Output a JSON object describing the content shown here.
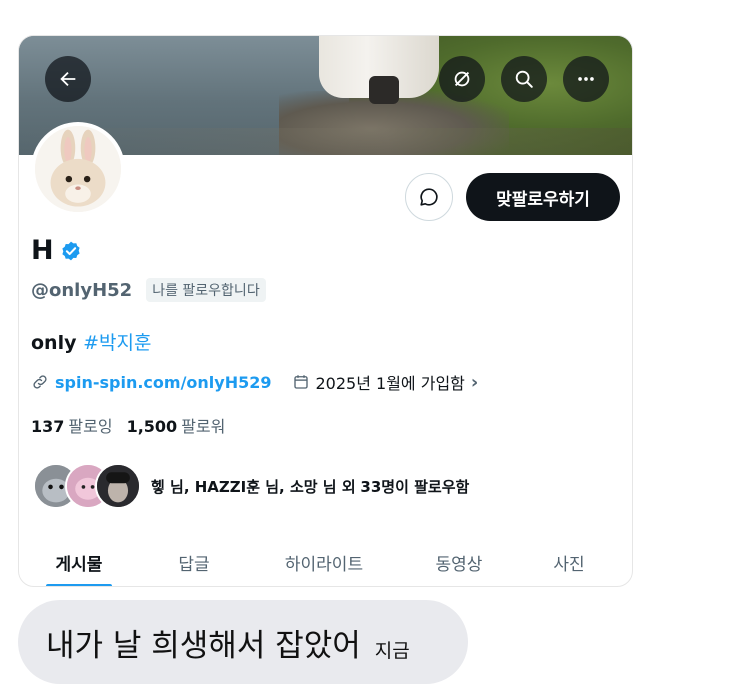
{
  "profile": {
    "name": "H",
    "handle": "@onlyH52",
    "follows_you": "나를 팔로우합니다",
    "bio_text": "only",
    "bio_hashtag": "#박지훈",
    "link": "spin-spin.com/onlyH529",
    "joined": "2025년 1월에 가입함",
    "following_count": "137",
    "following_label": "팔로잉",
    "followers_count": "1,500",
    "followers_label": "팔로워",
    "followed_by_names": "헿 님, HAZZI훈 님, 소망 님 외",
    "followed_by_count": "33",
    "followed_by_suffix": "명이 팔로우함"
  },
  "actions": {
    "follow_back_label": "맞팔로우하기"
  },
  "tabs": [
    {
      "label": "게시물",
      "active": true
    },
    {
      "label": "답글",
      "active": false
    },
    {
      "label": "하이라이트",
      "active": false
    },
    {
      "label": "동영상",
      "active": false
    },
    {
      "label": "사진",
      "active": false
    }
  ],
  "chat": {
    "message": "내가 날 희생해서 잡았어",
    "time": "지금"
  },
  "icons": {
    "back": "arrow-left-icon",
    "mute": "slashed-circle-icon",
    "search": "search-icon",
    "more": "more-dots-icon",
    "message": "message-bubble-icon",
    "verified": "verified-badge-icon",
    "link": "link-icon",
    "calendar": "calendar-icon"
  },
  "colors": {
    "accent": "#1d9bf0",
    "text_primary": "#0f1419",
    "text_secondary": "#536471",
    "bubble_bg": "#e9eaee"
  }
}
